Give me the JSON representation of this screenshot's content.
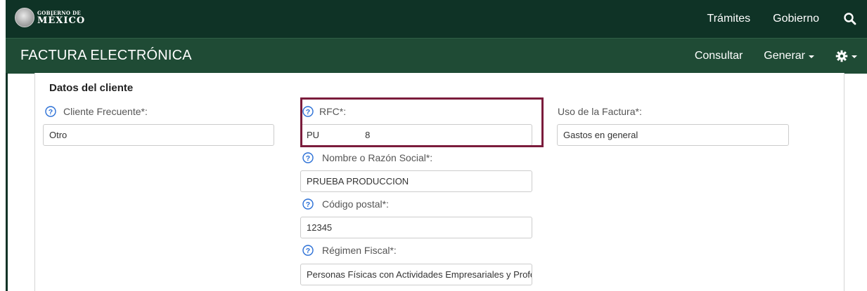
{
  "header": {
    "logo_small": "GOBIERNO DE",
    "logo_big": "MÉXICO",
    "links": [
      "Trámites",
      "Gobierno"
    ],
    "search_icon": "search-icon"
  },
  "subheader": {
    "title": "FACTURA ELECTRÓNICA",
    "consultar": "Consultar",
    "generar": "Generar",
    "settings_icon": "gear-icon"
  },
  "form": {
    "section_title": "Datos del cliente",
    "cliente_frecuente": {
      "label": "Cliente Frecuente*:",
      "value": "Otro"
    },
    "rfc": {
      "label": "RFC*:",
      "value": "PU                  8"
    },
    "uso_factura": {
      "label": "Uso de la Factura*:",
      "value": "Gastos en general"
    },
    "nombre": {
      "label": "Nombre o Razón Social*:",
      "value": "PRUEBA PRODUCCION"
    },
    "codigo_postal": {
      "label": "Código postal*:",
      "value": "12345"
    },
    "regimen": {
      "label": "Régimen Fiscal*:",
      "value": "Personas Físicas con Actividades Empresariales y Profesionales"
    }
  },
  "colors": {
    "header_bg": "#0f3326",
    "subheader_bg": "#1f4b35",
    "help_icon": "#2a6fd6",
    "highlight": "#7b1c3c"
  }
}
